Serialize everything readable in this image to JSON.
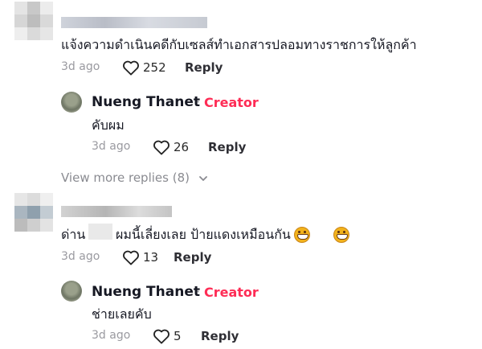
{
  "comments": [
    {
      "text": "แจ้งความดำเนินคดีกับเซลส์ทำเอกสารปลอมทางราชการให้ลูกค้า",
      "time": "3d ago",
      "likes": "252",
      "reply_label": "Reply",
      "reply": {
        "author": "Nueng Thanet",
        "separator": "·",
        "badge": "Creator",
        "text": "คับผม",
        "time": "3d ago",
        "likes": "26",
        "reply_label": "Reply"
      },
      "view_more": "View more replies (8)"
    },
    {
      "text_before": "ด่าน",
      "text_after": "ผมนี้เลี่ยงเลย ป้ายแดงเหมือนกัน",
      "emoji": [
        "grinning-face-emoji",
        "grinning-face-emoji"
      ],
      "time": "3d ago",
      "likes": "13",
      "reply_label": "Reply",
      "reply": {
        "author": "Nueng Thanet",
        "separator": "·",
        "badge": "Creator",
        "text": "ช่ายเลยคับ",
        "time": "3d ago",
        "likes": "5",
        "reply_label": "Reply"
      }
    }
  ],
  "icons": {
    "like": "heart-outline-icon",
    "expand": "chevron-down-icon"
  },
  "colors": {
    "creator": "#fe2c55",
    "muted": "#8a8b91"
  }
}
